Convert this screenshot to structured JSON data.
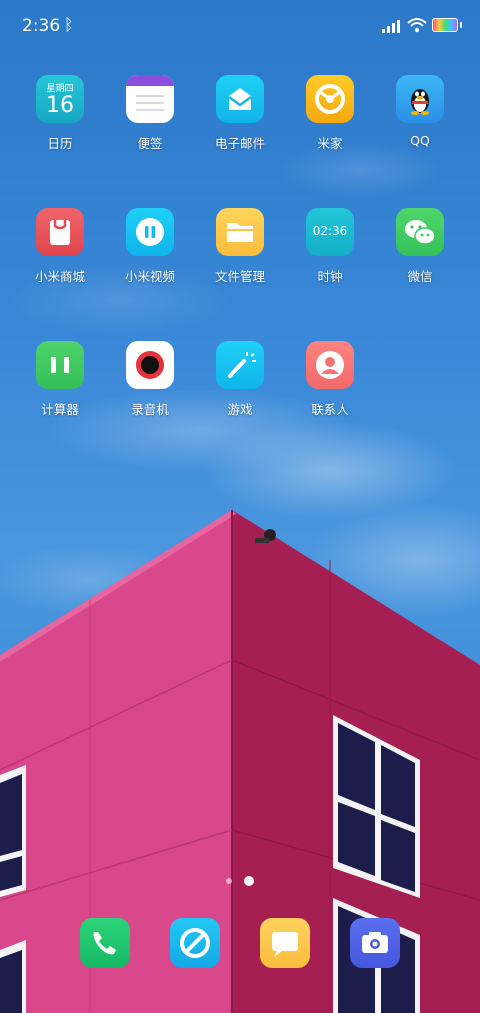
{
  "status_bar": {
    "time": "2:36",
    "bluetooth": "bluetooth-icon"
  },
  "apps": [
    {
      "label": "日历",
      "calendar_weekday": "星期四",
      "calendar_day": "16"
    },
    {
      "label": "便签"
    },
    {
      "label": "电子邮件"
    },
    {
      "label": "米家"
    },
    {
      "label": "QQ"
    },
    {
      "label": "小米商城"
    },
    {
      "label": "小米视频"
    },
    {
      "label": "文件管理"
    },
    {
      "label": "时钟",
      "clock_time": "02:36"
    },
    {
      "label": "微信"
    },
    {
      "label": "计算器"
    },
    {
      "label": "录音机"
    },
    {
      "label": "游戏"
    },
    {
      "label": "联系人"
    }
  ],
  "dock": [
    {
      "name": "phone"
    },
    {
      "name": "browser"
    },
    {
      "name": "messages"
    },
    {
      "name": "camera"
    }
  ],
  "pages": {
    "current": 2,
    "total": 2
  },
  "colors": {
    "sky": "#3a89d8",
    "building_front": "#d94a8a",
    "building_side": "#a8204f"
  }
}
